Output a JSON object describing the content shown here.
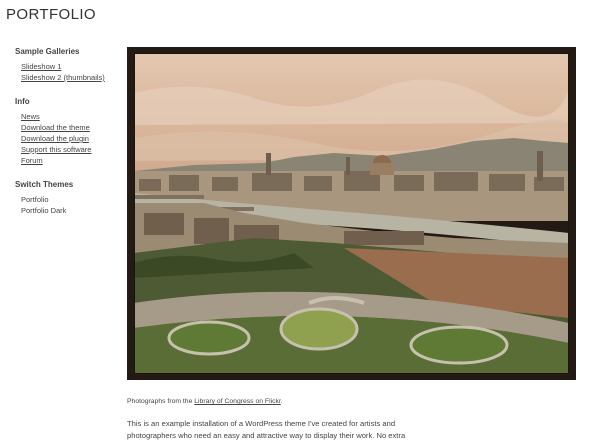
{
  "site": {
    "title": "PORTFOLIO"
  },
  "sidebar": {
    "sections": [
      {
        "heading": "Sample Galleries",
        "items": [
          "Slideshow 1",
          "Slideshow 2 (thumbnails)"
        ]
      },
      {
        "heading": "Info",
        "items": [
          "News",
          "Download the theme",
          "Download the plugin",
          "Support this software",
          "Forum"
        ]
      },
      {
        "heading": "Switch Themes",
        "items": [
          "Portfolio",
          "Portfolio Dark"
        ]
      }
    ]
  },
  "photo": {
    "frame_color": "#231a14",
    "sky_color": "#d8b79c"
  },
  "caption": {
    "prefix": "Photographs from the ",
    "link": "Library of Congress on Flickr",
    "suffix": "."
  },
  "intro": {
    "line1": "This is an example installation of a WordPress theme I've created for artists and",
    "line2": "photographers who need an easy and attractive way to display their work. No extra"
  }
}
